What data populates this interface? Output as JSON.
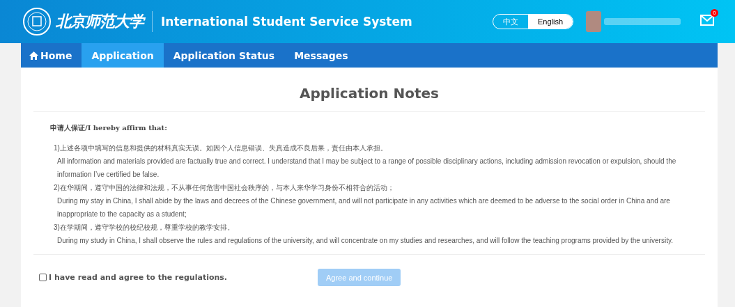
{
  "header": {
    "logo_text": "北京师范大学",
    "title": "International Student Service System",
    "languages": [
      {
        "label": "中文",
        "selected": false
      },
      {
        "label": "English",
        "selected": true
      }
    ],
    "mail_badge": "0"
  },
  "nav": [
    {
      "label": "Home",
      "kind": "home",
      "selected": false
    },
    {
      "label": "Application",
      "kind": "plain",
      "selected": true
    },
    {
      "label": "Application Status",
      "kind": "plain",
      "selected": false
    },
    {
      "label": "Messages",
      "kind": "plain",
      "selected": false
    }
  ],
  "page": {
    "title": "Application Notes",
    "heading": "申请人保证/I hereby affirm that:",
    "items": [
      {
        "zh": "1)上述各项中填写的信息和提供的材料真实无误。如因个人信息错误、失真造成不良后果，责任由本人承担。",
        "en": "All information and materials provided are factually true and correct. I understand that I may be subject to a range of possible disciplinary actions, including admission revocation or expulsion, should the information I’ve certified be false."
      },
      {
        "zh": "2)在华期间，遵守中国的法律和法规，不从事任何危害中国社会秩序的，与本人来华学习身份不相符合的活动；",
        "en": "During my stay in China, I shall abide by the laws and decrees of the Chinese government, and will not participate in any activities which are deemed to be adverse to the social order in China and are inappropriate to the capacity as a student;"
      },
      {
        "zh": "3)在学期间，遵守学校的校纪校规，尊重学校的教学安排。",
        "en": "During my study in China, I shall observe the rules and regulations of the university, and will concentrate on my studies and researches, and will follow the teaching programs provided by the university."
      }
    ],
    "agree": {
      "label": "I have read and agree to the regulations.",
      "checked": false
    },
    "button": {
      "label": "Agree and continue",
      "disabled": true
    }
  }
}
